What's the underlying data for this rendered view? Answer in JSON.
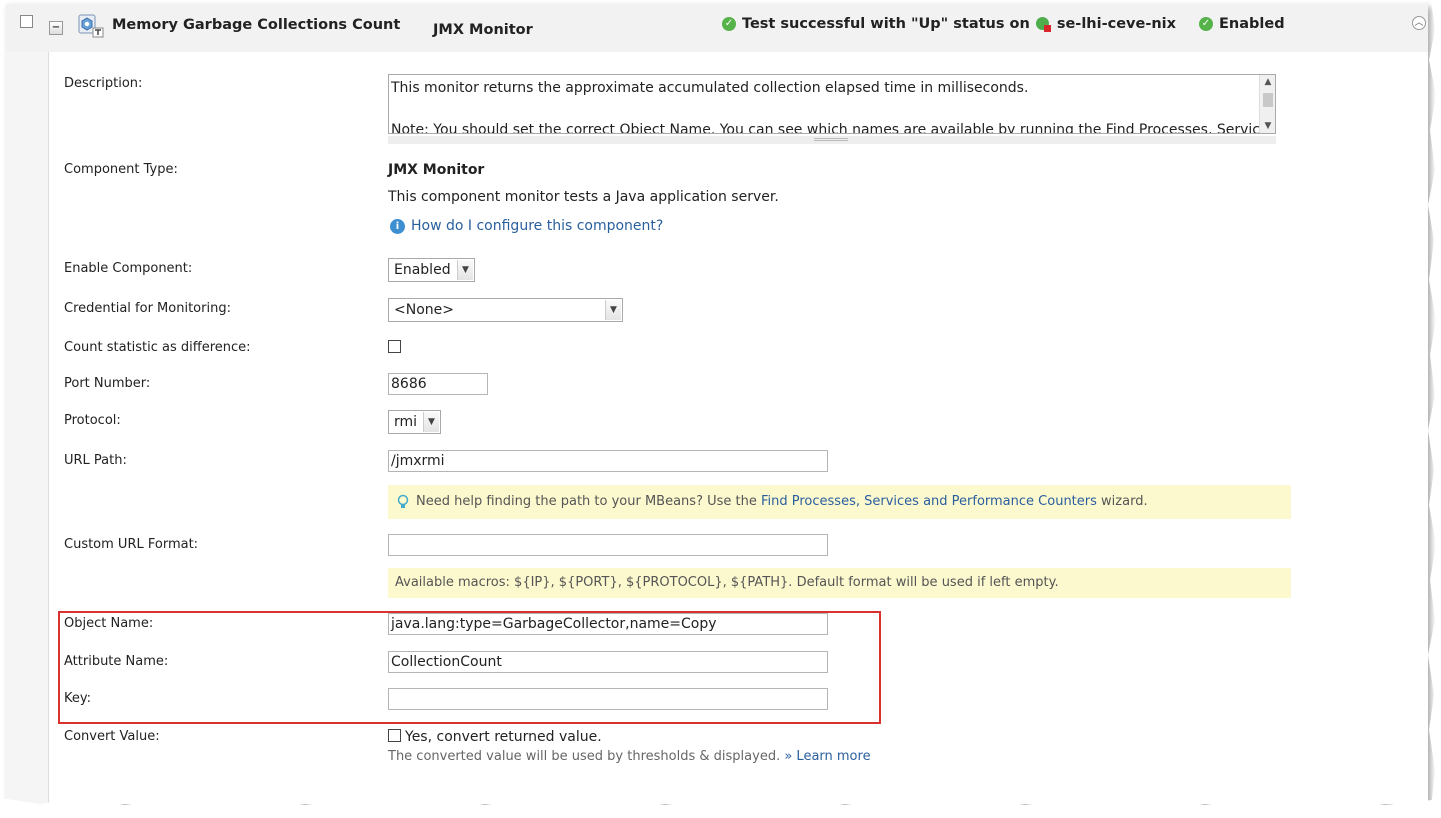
{
  "header": {
    "title": "Memory Garbage Collections Count",
    "component_type": "JMX Monitor",
    "test_status": "Test successful with \"Up\" status on",
    "node": "se-lhi-ceve-nix",
    "enabled_status": "Enabled",
    "collapse_glyph": "−"
  },
  "fields": {
    "description": {
      "label": "Description:",
      "line1": "This monitor returns the approximate accumulated collection elapsed time in milliseconds.",
      "line2": "Note: You should set the correct Object Name. You can see which names are available by running the Find Processes, Services,"
    },
    "component_type": {
      "label": "Component Type:",
      "name": "JMX Monitor",
      "description": "This component monitor tests a Java application server.",
      "help_link": "How do I configure this component?"
    },
    "enable_component": {
      "label": "Enable Component:",
      "value": "Enabled"
    },
    "credential": {
      "label": "Credential for Monitoring:",
      "value": "<None>"
    },
    "count_statistic": {
      "label": "Count statistic as difference:"
    },
    "port_number": {
      "label": "Port Number:",
      "value": "8686"
    },
    "protocol": {
      "label": "Protocol:",
      "value": "rmi"
    },
    "url_path": {
      "label": "URL Path:",
      "value": "/jmxrmi",
      "hint_prefix": "Need help finding the path to your MBeans? Use the",
      "hint_link": "Find Processes, Services and Performance Counters",
      "hint_suffix": "wizard."
    },
    "custom_url_format": {
      "label": "Custom URL Format:",
      "value": "",
      "hint": "Available macros: ${IP}, ${PORT}, ${PROTOCOL}, ${PATH}. Default format will be used if left empty."
    },
    "object_name": {
      "label": "Object Name:",
      "value": "java.lang:type=GarbageCollector,name=Copy"
    },
    "attribute_name": {
      "label": "Attribute Name:",
      "value": "CollectionCount"
    },
    "key": {
      "label": "Key:",
      "value": ""
    },
    "convert_value": {
      "label": "Convert Value:",
      "checkbox_label": "Yes, convert returned value.",
      "note": "The converted value will be used by thresholds & displayed.",
      "learn_more": "» Learn more"
    }
  },
  "colors": {
    "highlight_border": "#d9322e",
    "hint_background": "#fcf9cf",
    "link": "#2a5f9e",
    "ok_green": "#56b34a"
  }
}
